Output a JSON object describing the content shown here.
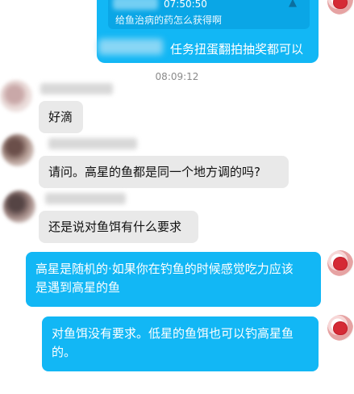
{
  "top_message": {
    "quote_time": "07:50:50",
    "quote_text": "给鱼治病的药怎么获得啊",
    "reply_text": "任务扭蛋翻拍抽奖都可以"
  },
  "timestamp": "08:09:12",
  "incoming": [
    {
      "text": "好滴"
    },
    {
      "text": "请问。高星的鱼都是同一个地方调的吗?"
    },
    {
      "text": "还是说对鱼饵有什么要求"
    }
  ],
  "outgoing": [
    {
      "line1": "高星是随机的·如果你在钓鱼的时候感觉吃力应该",
      "line2": "是遇到高星的鱼"
    },
    {
      "line1": "对鱼饵没有要求。低星的鱼饵也可以钓高星鱼",
      "line2": "的。"
    }
  ],
  "colors": {
    "outgoing_bubble": "#12b7f5",
    "incoming_bubble": "#e9e9e9",
    "timestamp": "#8a8a8a"
  },
  "icons": {
    "quote_arrow": "arrow-up-icon",
    "self_avatar": "apple-avatar-icon"
  }
}
